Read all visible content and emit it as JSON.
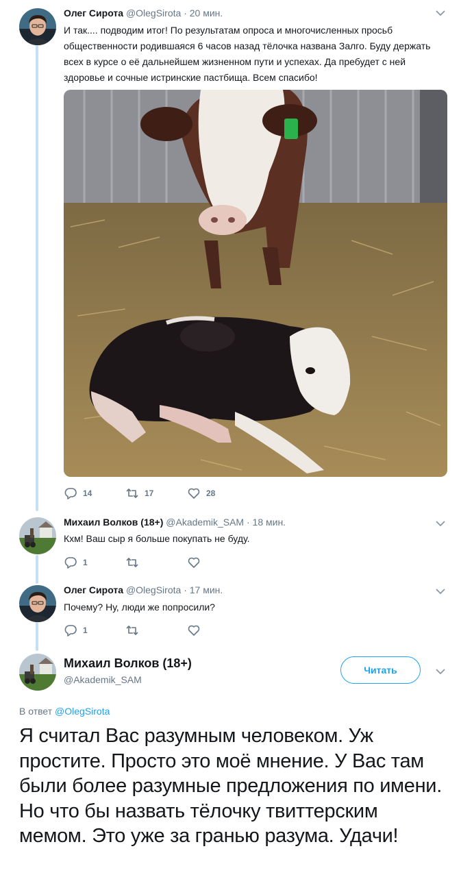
{
  "tweets": [
    {
      "author_name": "Олег Сирота",
      "handle": "@OlegSirota",
      "time": "20 мин.",
      "text": "И так.... подводим итог! По результатам опроса и многочисленных просьб общественности родившаяся 6 часов назад тёлочка названа Залго. Буду держать всех в курсе о её дальнейшем жизненном пути и успехах.  Да пребудет с ней здоровье и сочные истринские пастбища. Всем спасибо!",
      "replies": "14",
      "retweets": "17",
      "likes": "28"
    },
    {
      "author_name": "Михаил Волков (18+)",
      "handle": "@Akademik_SAM",
      "time": "18 мин.",
      "text": "Кхм! Ваш сыр я больше покупать не буду.",
      "replies": "1",
      "retweets": "",
      "likes": ""
    },
    {
      "author_name": "Олег Сирота",
      "handle": "@OlegSirota",
      "time": "17 мин.",
      "text": "Почему? Ну, люди же попросили?",
      "replies": "1",
      "retweets": "",
      "likes": ""
    }
  ],
  "focused": {
    "author_name": "Михаил Волков (18+)",
    "handle": "@Akademik_SAM",
    "follow_label": "Читать",
    "reply_prefix": "В ответ",
    "reply_to": "@OlegSirota",
    "text": "Я считал Вас разумным человеком. Уж простите. Просто это моё мнение. У Вас там были более разумные предложения по имени. Но что бы назвать тёлочку твиттерским мемом. Это уже за гранью разума. Удачи!"
  },
  "colors": {
    "accent": "#1da1f2",
    "secondary_text": "#657786",
    "thread_line": "#c4dff6",
    "ear_tag": "#2bb24c"
  },
  "icons": [
    "reply-icon",
    "retweet-icon",
    "like-icon",
    "chevron-down-icon"
  ]
}
